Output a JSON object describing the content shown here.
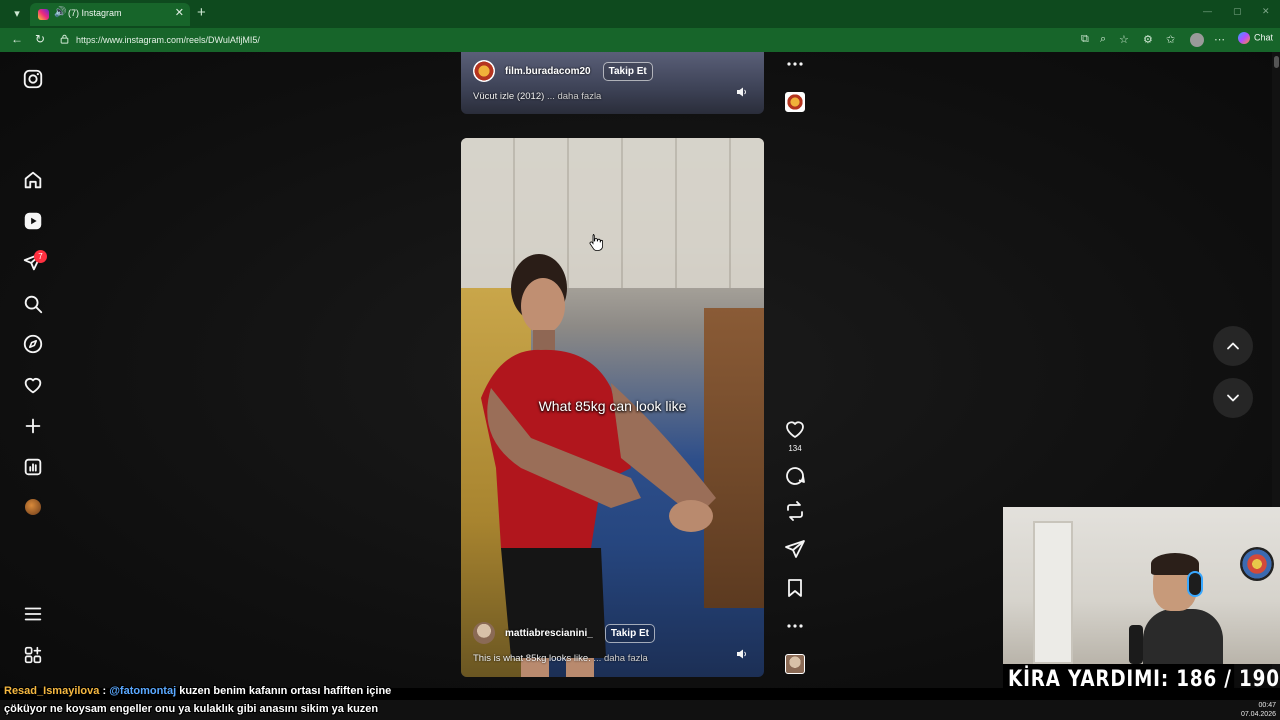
{
  "browser": {
    "tab_title": "(7) Instagram",
    "tab_audio_icon": "speaker-icon",
    "url": "https://www.instagram.com/reels/DWulAfljMI5/",
    "chat_label": "Chat"
  },
  "sidebar": {
    "notification_count": "7",
    "items": [
      {
        "name": "instagram-logo-icon"
      },
      {
        "name": "home-icon"
      },
      {
        "name": "reels-icon"
      },
      {
        "name": "messages-icon"
      },
      {
        "name": "search-icon"
      },
      {
        "name": "explore-icon"
      },
      {
        "name": "notifications-icon"
      },
      {
        "name": "create-icon"
      },
      {
        "name": "dashboard-icon"
      },
      {
        "name": "profile-avatar"
      },
      {
        "name": "more-menu-icon"
      },
      {
        "name": "apps-icon"
      }
    ]
  },
  "reels": [
    {
      "username": "film.buradacom20",
      "follow_label": "Takip Et",
      "caption": "Vücut izle (2012)",
      "more_label": "... daha fazla"
    },
    {
      "overlay_text": "What 85kg can look like",
      "username": "mattiabrescianini_",
      "follow_label": "Takip Et",
      "caption": "This is what 85kg looks like.",
      "more_label": "... daha fazla",
      "like_count": "134"
    }
  ],
  "stream": {
    "rent_label": "KİRA YARDIMI:",
    "rent_progress": "186 / 190",
    "chat_user": "Resad_Ismayilova",
    "chat_sep": " :",
    "chat_mention": "@fatomontaj",
    "chat_line1": "kuzen benim kafanın ortası hafiften içine",
    "chat_line2": "çöküyor ne koysam engeller onu ya kulaklık gibi anasını sikim ya kuzen",
    "clock_time": "00:47",
    "clock_date": "07.04.2026"
  },
  "colors": {
    "chrome": "#17652a",
    "chrome_dark": "#0e4a1e",
    "page_bg": "#0f0f0f",
    "notification": "#ff3040",
    "chat_user": "#f4b740",
    "chat_mention": "#5aa8ff"
  }
}
